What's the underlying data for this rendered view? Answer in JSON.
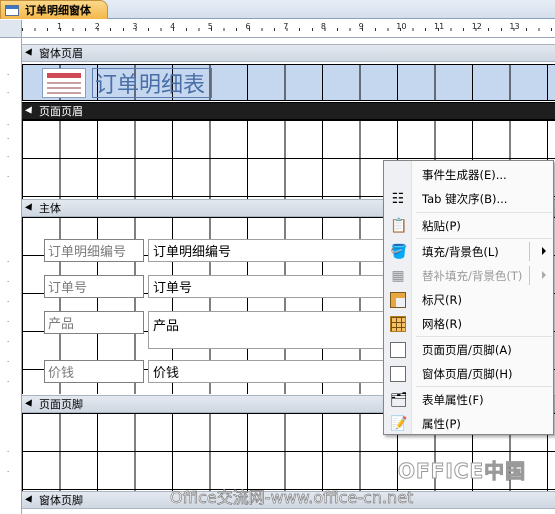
{
  "document_tab": {
    "title": "订单明细窗体",
    "icon": "form-icon"
  },
  "ruler": {
    "horizontal_numbers": [
      "1",
      "2",
      "3",
      "4",
      "5",
      "6",
      "7",
      "8",
      "9",
      "10",
      "11",
      "12",
      "13"
    ]
  },
  "sections": {
    "form_header": "窗体页眉",
    "page_header": "页面页眉",
    "detail": "主体",
    "page_footer": "页面页脚",
    "form_footer": "窗体页脚"
  },
  "header": {
    "title_label": "订单明细表",
    "logo_icon": "form-logo-icon"
  },
  "fields": [
    {
      "label": "订单明细编号",
      "value": "订单明细编号"
    },
    {
      "label": "订单号",
      "value": "订单号"
    },
    {
      "label": "产品",
      "value": "产品"
    },
    {
      "label": "价钱",
      "value": "价钱"
    }
  ],
  "context_menu": {
    "items": [
      {
        "label": "事件生成器(E)...",
        "icon": "event-builder-icon",
        "enabled": true
      },
      {
        "label": "Tab 键次序(B)...",
        "icon": "tab-order-icon",
        "enabled": true
      },
      {
        "label": "粘贴(P)",
        "icon": "paste-icon",
        "enabled": true
      },
      {
        "label": "填充/背景色(L)",
        "icon": "fill-color-icon",
        "enabled": true,
        "submenu": true
      },
      {
        "label": "替补填充/背景色(T)",
        "icon": "alt-fill-color-icon",
        "enabled": false,
        "submenu": true
      },
      {
        "label": "标尺(R)",
        "icon": "ruler-icon",
        "enabled": true
      },
      {
        "label": "网格(R)",
        "icon": "grid-icon",
        "enabled": true
      },
      {
        "label": "页面页眉/页脚(A)",
        "icon": "page-header-footer-icon",
        "enabled": true
      },
      {
        "label": "窗体页眉/页脚(H)",
        "icon": "form-header-footer-icon",
        "enabled": true
      },
      {
        "label": "表单属性(F)",
        "icon": "form-properties-icon",
        "enabled": true
      },
      {
        "label": "属性(P)",
        "icon": "properties-icon",
        "enabled": true
      }
    ]
  },
  "watermarks": {
    "brand": "OFFICE中国",
    "site": "Office交流网-www.office-cn.net"
  },
  "colors": {
    "tab_accent": "#f4b84a",
    "header_band": "#c4d7ee",
    "page_header_bar": "#1e1e1e"
  }
}
